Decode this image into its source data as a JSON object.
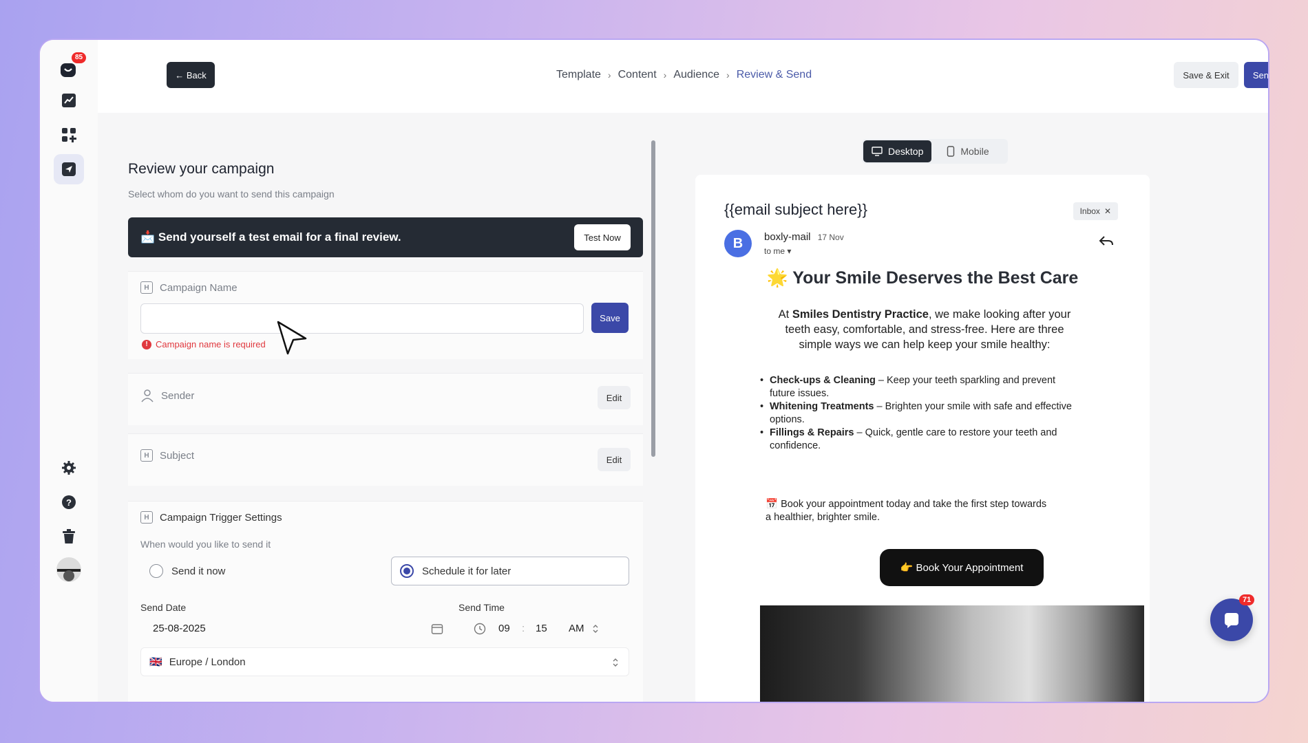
{
  "header": {
    "back_label": "← Back",
    "breadcrumbs": [
      "Template",
      "Content",
      "Audience",
      "Review & Send"
    ],
    "save_exit_label": "Save & Exit",
    "send_label": "Send"
  },
  "sidebar": {
    "notification_badge": "85",
    "items": [
      {
        "icon": "analytics-icon"
      },
      {
        "icon": "apps-grid-icon"
      },
      {
        "icon": "send-icon",
        "active": true
      },
      {
        "icon": "gear-icon"
      },
      {
        "icon": "help-icon"
      },
      {
        "icon": "trash-icon"
      }
    ]
  },
  "review": {
    "title": "Review your campaign",
    "subtitle": "Select whom do you want to send this campaign",
    "test_bar_text": "📩 Send yourself a test email for a final review.",
    "test_now_label": "Test Now",
    "campaign_name_label": "Campaign Name",
    "campaign_name_value": "",
    "save_label": "Save",
    "error_text": "Campaign name is required",
    "sender_label": "Sender",
    "subject_label": "Subject",
    "edit_label": "Edit",
    "trigger_title": "Campaign Trigger Settings",
    "trigger_question": "When would you like to send it",
    "option_now": "Send it now",
    "option_later": "Schedule it for later",
    "selected_option": "later",
    "send_date_label": "Send Date",
    "send_date_value": "25-08-2025",
    "send_time_label": "Send Time",
    "hour": "09",
    "minute": "15",
    "ampm": "AM",
    "timezone": "Europe / London",
    "timezone_flag": "🇬🇧"
  },
  "preview": {
    "desktop_label": "Desktop",
    "mobile_label": "Mobile",
    "active_view": "desktop",
    "subject": "{{email subject here}}",
    "inbox_chip": "Inbox",
    "avatar_letter": "B",
    "sender_name": "boxly-mail",
    "sender_date": "17 Nov",
    "to_me": "to me",
    "heading": "🌟 Your Smile Deserves the Best Care",
    "intro_prefix": "At ",
    "intro_bold": "Smiles Dentistry Practice",
    "intro_suffix": ", we make looking after your teeth easy, comfortable, and stress-free. Here are three simple ways we can help keep your smile healthy:",
    "list": [
      {
        "bold": "Check-ups & Cleaning",
        "text": " – Keep your teeth sparkling and prevent future issues."
      },
      {
        "bold": "Whitening Treatments",
        "text": " – Brighten your smile with safe and effective options."
      },
      {
        "bold": "Fillings & Repairs",
        "text": " – Quick, gentle care to restore your teeth and confidence."
      }
    ],
    "cta_text": "📅 Book your appointment today and take the first step towards a healthier, brighter smile.",
    "book_button": "👉 Book Your Appointment"
  },
  "chat": {
    "badge": "71"
  },
  "colors": {
    "accent": "#3b48a8",
    "dark": "#252b34",
    "error": "#e0383e"
  }
}
